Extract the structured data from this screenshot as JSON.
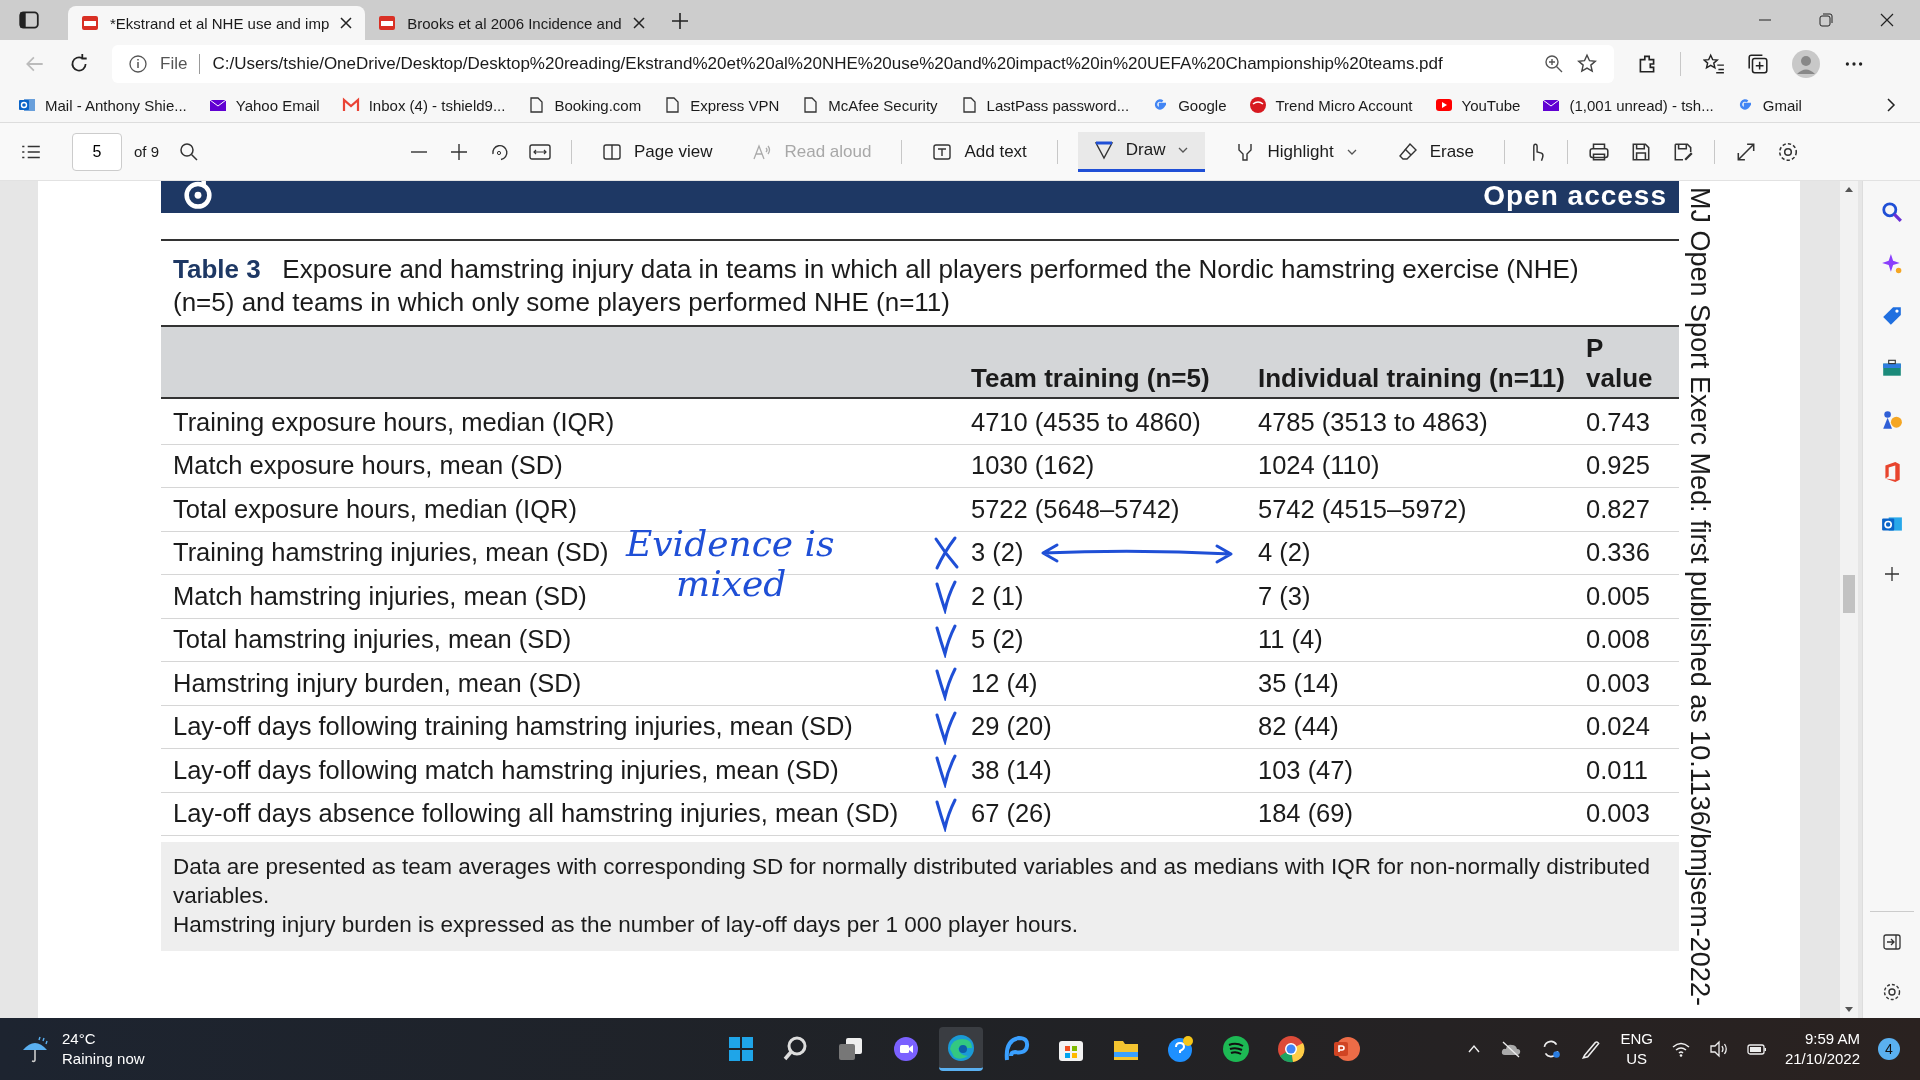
{
  "browser": {
    "tabs": [
      {
        "title": "*Ekstrand et al NHE use and imp",
        "selected": true
      },
      {
        "title": "Brooks et al 2006 Incidence and",
        "selected": false
      }
    ],
    "address": {
      "scheme": "File",
      "url": "C:/Users/tshie/OneDrive/Desktop/Desktop%20reading/Ekstrand%20et%20al%20NHE%20use%20and%20impact%20in%20UEFA%20Championship%20teams.pdf"
    },
    "bookmarks": [
      {
        "label": "Mail - Anthony Shie...",
        "kind": "outlook"
      },
      {
        "label": "Yahoo Email",
        "kind": "mail"
      },
      {
        "label": "Inbox (4) - tshield9...",
        "kind": "gmail"
      },
      {
        "label": "Booking.com",
        "kind": "page"
      },
      {
        "label": "Express VPN",
        "kind": "page"
      },
      {
        "label": "McAfee Security",
        "kind": "page"
      },
      {
        "label": "LastPass password...",
        "kind": "page"
      },
      {
        "label": "Google",
        "kind": "google"
      },
      {
        "label": "Trend Micro Account",
        "kind": "trend"
      },
      {
        "label": "YouTube",
        "kind": "youtube"
      },
      {
        "label": "(1,001 unread) - tsh...",
        "kind": "mail"
      },
      {
        "label": "Gmail",
        "kind": "google"
      }
    ]
  },
  "pdf_toolbar": {
    "page": "5",
    "page_count": "of 9",
    "tools": [
      {
        "label": "Page view",
        "kind": "pageview",
        "disabled": false,
        "selected": false
      },
      {
        "label": "Read aloud",
        "kind": "read",
        "disabled": true,
        "selected": false
      },
      {
        "label": "Add text",
        "kind": "text",
        "disabled": false,
        "selected": false
      },
      {
        "label": "Draw",
        "kind": "draw",
        "disabled": false,
        "selected": true
      },
      {
        "label": "Highlight",
        "kind": "highlight",
        "disabled": false,
        "selected": false
      },
      {
        "label": "Erase",
        "kind": "erase",
        "disabled": false,
        "selected": false
      }
    ]
  },
  "document": {
    "banner": "Open access",
    "table_number": "Table 3",
    "caption": "Exposure and hamstring injury data in teams in which all players performed the Nordic hamstring exercise (NHE) (n=5) and teams in which only some players performed NHE (n=11)",
    "columns": [
      "",
      "Team training (n=5)",
      "Individual training (n=11)",
      "P value"
    ],
    "rows": [
      {
        "kind": "plain",
        "cells": [
          "Training exposure hours, median (IQR)",
          "4710 (4535 to 4860)",
          "4785 (3513 to 4863)",
          "0.743"
        ]
      },
      {
        "kind": "plain",
        "cells": [
          "Match exposure hours, mean (SD)",
          "1030 (162)",
          "1024 (110)",
          "0.925"
        ]
      },
      {
        "kind": "plain",
        "cells": [
          "Total exposure hours, median (IQR)",
          "5722 (5648–5742)",
          "5742 (4515–5972)",
          "0.827"
        ]
      },
      {
        "kind": "crossed",
        "cells": [
          "Training hamstring injuries, mean (SD)",
          "3 (2)",
          "4 (2)",
          "0.336"
        ],
        "arrow": true,
        "note": [
          "Evidence is",
          "mixed"
        ]
      },
      {
        "kind": "ticked",
        "cells": [
          "Match hamstring injuries, mean (SD)",
          "2 (1)",
          "7 (3)",
          "0.005"
        ]
      },
      {
        "kind": "ticked",
        "cells": [
          "Total hamstring injuries, mean (SD)",
          "5 (2)",
          "11 (4)",
          "0.008"
        ]
      },
      {
        "kind": "ticked",
        "cells": [
          "Hamstring injury burden, mean (SD)",
          "12 (4)",
          "35 (14)",
          "0.003"
        ]
      },
      {
        "kind": "ticked",
        "cells": [
          "Lay-off days following training hamstring injuries, mean (SD)",
          "29 (20)",
          "82 (44)",
          "0.024"
        ]
      },
      {
        "kind": "ticked",
        "cells": [
          "Lay-off days following match hamstring injuries, mean (SD)",
          "38 (14)",
          "103 (47)",
          "0.011"
        ]
      },
      {
        "kind": "ticked",
        "cells": [
          "Lay-off days absence following all hamstring injuries, mean (SD)",
          "67 (26)",
          "184 (69)",
          "0.003"
        ]
      }
    ],
    "footnotes": [
      "Data are presented as team averages with corresponding SD for normally distributed variables and as medians with IQR for non-normally distributed variables.",
      "Hamstring injury burden is expressed as the number of lay-off days per 1 000 player hours."
    ],
    "margin_text": "MJ Open Sport Exerc Med: first published as 10.1136/bmjsem-2022-"
  },
  "taskbar": {
    "weather": {
      "temperature": "24°C",
      "condition": "Raining now"
    },
    "language": "ENG",
    "region": "US",
    "time": "9:59 AM",
    "date": "21/10/2022",
    "notification_count": "4"
  }
}
